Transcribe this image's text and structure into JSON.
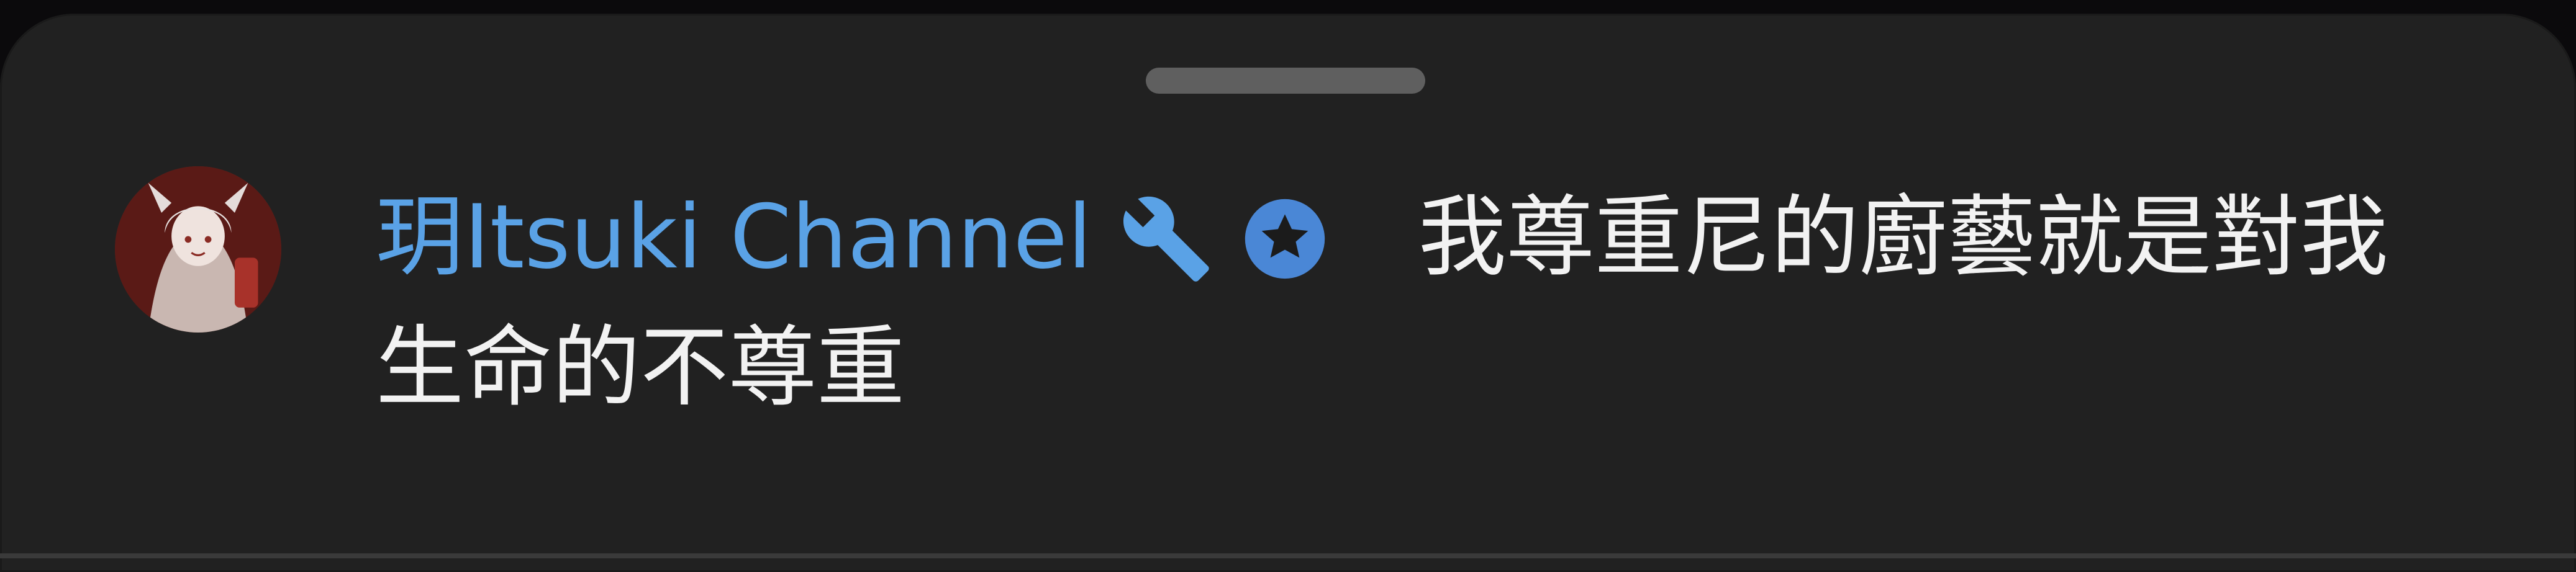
{
  "sheet": {
    "background_color": "#212121",
    "handle_color": "#5f5f5f"
  },
  "comment": {
    "avatar_icon": "avatar-image",
    "author": "玥Itsuki Channel",
    "author_color": "#5aa2e6",
    "badges": [
      "wrench-icon",
      "verified-star-icon"
    ],
    "text_line_1": "我尊重尼的廚藝就是對我",
    "text_line_2": "生命的不尊重"
  }
}
